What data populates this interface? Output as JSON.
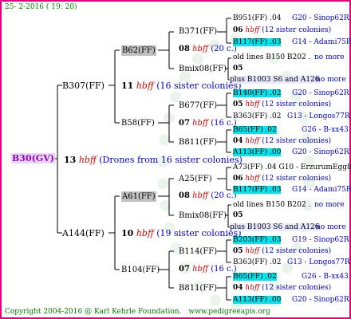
{
  "header": {
    "date": "25- 2-2016 ( 19: 20)"
  },
  "footer": {
    "copyright": "Copyright 2004-2016 @ Karl Kehrle Foundation.",
    "site": "www.pedigreeapis.org"
  },
  "root": {
    "label": "B30(GV)",
    "num": "13",
    "hbff": "hbff",
    "note": "(Drones from 16 sister colonies)"
  },
  "gen1": [
    {
      "label": "B307(FF)",
      "num": "11",
      "hbff": "hbff",
      "note": "(16 sister colonies)"
    },
    {
      "label": "A144(FF)",
      "num": "10",
      "hbff": "hbff",
      "note": "(19 sister colonies)"
    }
  ],
  "gen2": [
    {
      "label": "B62(FF)",
      "num": "08",
      "hbff": "hbff",
      "note": "(20 c.)"
    },
    {
      "label": "B58(FF)",
      "num": "07",
      "hbff": "hbff",
      "note": "(16 c.)"
    },
    {
      "label": "A61(FF)",
      "num": "08",
      "hbff": "hbff",
      "note": "(20 c.)"
    },
    {
      "label": "B104(FF)",
      "num": "07",
      "hbff": "hbff",
      "note": "(16 c.)"
    }
  ],
  "gen3": [
    {
      "label": "B371(FF)"
    },
    {
      "label": "Bmix08(FF)"
    },
    {
      "label": "B677(FF)"
    },
    {
      "label": "B811(FF)"
    },
    {
      "label": "A25(FF)"
    },
    {
      "label": "Bmix08(FF)"
    },
    {
      "label": "B114(FF)"
    },
    {
      "label": "B811(FF)"
    }
  ],
  "gen4": [
    {
      "a": "B951(FF) .04",
      "b": "G20 - Sinop62R"
    },
    {
      "num": "06",
      "hbff": "hbff",
      "note": "(12 sister colonies)"
    },
    {
      "a": "B117(FF) .03",
      "b": "G14 - Adami75R"
    },
    {
      "a": "old lines B150 B202 .",
      "b": "no more"
    },
    {
      "num": "05"
    },
    {
      "a": "plus B1003 S6 and A126",
      "b": "no more"
    },
    {
      "a": "B140(FF) .02",
      "b": "G20 - Sinop62R"
    },
    {
      "num": "05",
      "hbff": "hbff",
      "note": "(12 sister colonies)"
    },
    {
      "a": "B363(FF) .02",
      "b": "G13 - Longos77R"
    },
    {
      "a": "B65(FF) .02",
      "b": "G26 - B-xx43"
    },
    {
      "num": "04",
      "hbff": "hbff",
      "note": "(12 sister colonies)"
    },
    {
      "a": "A113(FF) .00",
      "b": "G20 - Sinop62R"
    },
    {
      "a": "A73(FF) .04 G10 - ErzurumEgg8",
      "b": ""
    },
    {
      "num": "06",
      "hbff": "hbff",
      "note": "(12 sister colonies)"
    },
    {
      "a": "B117(FF) .03",
      "b": "G14 - Adami75R"
    },
    {
      "a": "old lines B150 B202 .",
      "b": "no more"
    },
    {
      "num": "05"
    },
    {
      "a": "plus B1003 S6 and A126",
      "b": "no more"
    },
    {
      "a": "B203(FF) .03",
      "b": "G19 - Sinop62R"
    },
    {
      "num": "05",
      "hbff": "hbff",
      "note": "(12 sister colonies)"
    },
    {
      "a": "B363(FF) .02",
      "b": "G13 - Longos77R"
    },
    {
      "a": "B65(FF) .02",
      "b": "G26 - B-xx43"
    },
    {
      "num": "04",
      "hbff": "hbff",
      "note": "(12 sister colonies)"
    },
    {
      "a": "A113(FF) .00",
      "b": "G20 - Sinop62R"
    }
  ]
}
